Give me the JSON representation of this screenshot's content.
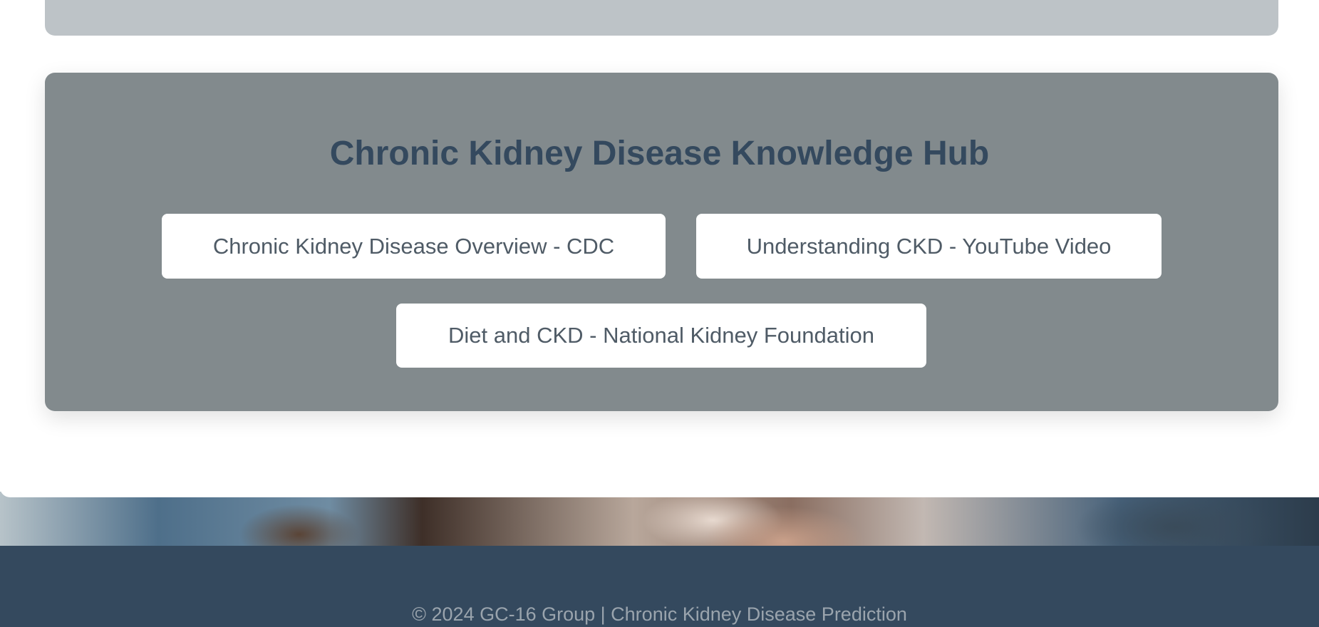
{
  "knowledge_hub": {
    "title": "Chronic Kidney Disease Knowledge Hub",
    "links": [
      {
        "label": "Chronic Kidney Disease Overview - CDC"
      },
      {
        "label": "Understanding CKD - YouTube Video"
      },
      {
        "label": "Diet and CKD - National Kidney Foundation"
      }
    ]
  },
  "footer": {
    "text": "© 2024 GC-16 Group | Chronic Kidney Disease Prediction"
  },
  "colors": {
    "title": "#34495e",
    "hub_background": "#828a8d",
    "top_card_background": "#bdc3c7",
    "footer_background": "#34495e",
    "button_background": "#ffffff",
    "button_text": "#4f5b66"
  }
}
